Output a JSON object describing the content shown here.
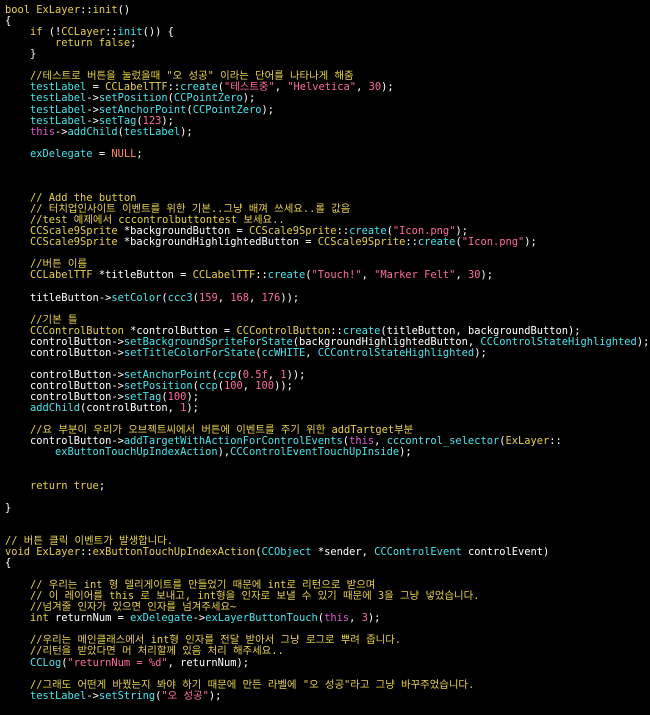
{
  "colors": {
    "background": "#000000",
    "keyword": "#e7d04a",
    "function": "#46e6ef",
    "string": "#ff6ba0",
    "text": "#ffffff",
    "comment": "#e7d04a",
    "macro": "#ff8a6a"
  },
  "lines": [
    {
      "row": 0,
      "indent": 0,
      "segments": [
        {
          "c": "kw",
          "t": "bool "
        },
        {
          "c": "ty",
          "t": "ExLayer"
        },
        {
          "c": "tx",
          "t": "::"
        },
        {
          "c": "ty",
          "t": "init"
        },
        {
          "c": "tx",
          "t": "()"
        }
      ]
    },
    {
      "row": 1,
      "indent": 0,
      "segments": [
        {
          "c": "tx",
          "t": "{"
        }
      ]
    },
    {
      "row": 2,
      "indent": 4,
      "segments": [
        {
          "c": "kw",
          "t": "if "
        },
        {
          "c": "tx",
          "t": "(!"
        },
        {
          "c": "ty",
          "t": "CCLayer"
        },
        {
          "c": "tx",
          "t": "::"
        },
        {
          "c": "fn",
          "t": "init"
        },
        {
          "c": "tx",
          "t": "()) {"
        }
      ]
    },
    {
      "row": 3,
      "indent": 8,
      "segments": [
        {
          "c": "kw",
          "t": "return false"
        },
        {
          "c": "tx",
          "t": ";"
        }
      ]
    },
    {
      "row": 4,
      "indent": 4,
      "segments": [
        {
          "c": "tx",
          "t": "}"
        }
      ]
    },
    {
      "row": 6,
      "indent": 4,
      "segments": [
        {
          "c": "cm",
          "t": "//테스트로 버튼을 눌렀을때 \"오 성공\" 이라는 단어를 나타나게 해줌"
        }
      ]
    },
    {
      "row": 7,
      "indent": 4,
      "segments": [
        {
          "c": "fn",
          "t": "testLabel"
        },
        {
          "c": "tx",
          "t": " = "
        },
        {
          "c": "ty",
          "t": "CCLabelTTF"
        },
        {
          "c": "tx",
          "t": "::"
        },
        {
          "c": "fn",
          "t": "create"
        },
        {
          "c": "tx",
          "t": "("
        },
        {
          "c": "str",
          "t": "\"테스트중\""
        },
        {
          "c": "tx",
          "t": ", "
        },
        {
          "c": "str",
          "t": "\"Helvetica\""
        },
        {
          "c": "tx",
          "t": ", "
        },
        {
          "c": "num",
          "t": "30"
        },
        {
          "c": "tx",
          "t": ");"
        }
      ]
    },
    {
      "row": 8,
      "indent": 4,
      "segments": [
        {
          "c": "fn",
          "t": "testLabel"
        },
        {
          "c": "tx",
          "t": "->"
        },
        {
          "c": "fn",
          "t": "setPosition"
        },
        {
          "c": "tx",
          "t": "("
        },
        {
          "c": "fn",
          "t": "CCPointZero"
        },
        {
          "c": "tx",
          "t": ");"
        }
      ]
    },
    {
      "row": 9,
      "indent": 4,
      "segments": [
        {
          "c": "fn",
          "t": "testLabel"
        },
        {
          "c": "tx",
          "t": "->"
        },
        {
          "c": "fn",
          "t": "setAnchorPoint"
        },
        {
          "c": "tx",
          "t": "("
        },
        {
          "c": "fn",
          "t": "CCPointZero"
        },
        {
          "c": "tx",
          "t": ");"
        }
      ]
    },
    {
      "row": 10,
      "indent": 4,
      "segments": [
        {
          "c": "fn",
          "t": "testLabel"
        },
        {
          "c": "tx",
          "t": "->"
        },
        {
          "c": "fn",
          "t": "setTag"
        },
        {
          "c": "tx",
          "t": "("
        },
        {
          "c": "num",
          "t": "123"
        },
        {
          "c": "tx",
          "t": ");"
        }
      ]
    },
    {
      "row": 11,
      "indent": 4,
      "segments": [
        {
          "c": "pk",
          "t": "this"
        },
        {
          "c": "tx",
          "t": "->"
        },
        {
          "c": "fn",
          "t": "addChild"
        },
        {
          "c": "tx",
          "t": "("
        },
        {
          "c": "fn",
          "t": "testLabel"
        },
        {
          "c": "tx",
          "t": ");"
        }
      ]
    },
    {
      "row": 13,
      "indent": 4,
      "segments": [
        {
          "c": "fn",
          "t": "exDelegate"
        },
        {
          "c": "tx",
          "t": " = "
        },
        {
          "c": "mac",
          "t": "NULL"
        },
        {
          "c": "tx",
          "t": ";"
        }
      ]
    },
    {
      "row": 17,
      "indent": 4,
      "segments": [
        {
          "c": "cm",
          "t": "// Add the button"
        }
      ]
    },
    {
      "row": 18,
      "indent": 4,
      "segments": [
        {
          "c": "cm",
          "t": "// 터치업인사이트 이벤트를 위한 기본..그냥 배껴 쓰세요..롤 값음"
        }
      ]
    },
    {
      "row": 19,
      "indent": 4,
      "segments": [
        {
          "c": "cm",
          "t": "//test 예제에서 cccontrolbuttontest 보세요.."
        }
      ]
    },
    {
      "row": 20,
      "indent": 4,
      "segments": [
        {
          "c": "ty",
          "t": "CCScale9Sprite"
        },
        {
          "c": "tx",
          "t": " *backgroundButton = "
        },
        {
          "c": "ty",
          "t": "CCScale9Sprite"
        },
        {
          "c": "tx",
          "t": "::"
        },
        {
          "c": "fn",
          "t": "create"
        },
        {
          "c": "tx",
          "t": "("
        },
        {
          "c": "str",
          "t": "\"Icon.png\""
        },
        {
          "c": "tx",
          "t": ");"
        }
      ]
    },
    {
      "row": 21,
      "indent": 4,
      "segments": [
        {
          "c": "ty",
          "t": "CCScale9Sprite"
        },
        {
          "c": "tx",
          "t": " *backgroundHighlightedButton = "
        },
        {
          "c": "ty",
          "t": "CCScale9Sprite"
        },
        {
          "c": "tx",
          "t": "::"
        },
        {
          "c": "fn",
          "t": "create"
        },
        {
          "c": "tx",
          "t": "("
        },
        {
          "c": "str",
          "t": "\"Icon.png\""
        },
        {
          "c": "tx",
          "t": ");"
        }
      ]
    },
    {
      "row": 23,
      "indent": 4,
      "segments": [
        {
          "c": "cm",
          "t": "//버튼 이름"
        }
      ]
    },
    {
      "row": 24,
      "indent": 4,
      "segments": [
        {
          "c": "ty",
          "t": "CCLabelTTF"
        },
        {
          "c": "tx",
          "t": " *titleButton = "
        },
        {
          "c": "ty",
          "t": "CCLabelTTF"
        },
        {
          "c": "tx",
          "t": "::"
        },
        {
          "c": "fn",
          "t": "create"
        },
        {
          "c": "tx",
          "t": "("
        },
        {
          "c": "str",
          "t": "\"Touch!\""
        },
        {
          "c": "tx",
          "t": ", "
        },
        {
          "c": "str",
          "t": "\"Marker Felt\""
        },
        {
          "c": "tx",
          "t": ", "
        },
        {
          "c": "num",
          "t": "30"
        },
        {
          "c": "tx",
          "t": ");"
        }
      ]
    },
    {
      "row": 26,
      "indent": 4,
      "segments": [
        {
          "c": "tx",
          "t": "titleButton->"
        },
        {
          "c": "fn",
          "t": "setColor"
        },
        {
          "c": "tx",
          "t": "("
        },
        {
          "c": "fn",
          "t": "ccc3"
        },
        {
          "c": "tx",
          "t": "("
        },
        {
          "c": "num",
          "t": "159"
        },
        {
          "c": "tx",
          "t": ", "
        },
        {
          "c": "num",
          "t": "168"
        },
        {
          "c": "tx",
          "t": ", "
        },
        {
          "c": "num",
          "t": "176"
        },
        {
          "c": "tx",
          "t": "));"
        }
      ]
    },
    {
      "row": 28,
      "indent": 4,
      "segments": [
        {
          "c": "cm",
          "t": "//기본 틀"
        }
      ]
    },
    {
      "row": 29,
      "indent": 4,
      "segments": [
        {
          "c": "ty",
          "t": "CCControlButton"
        },
        {
          "c": "tx",
          "t": " *controlButton = "
        },
        {
          "c": "ty",
          "t": "CCControlButton"
        },
        {
          "c": "tx",
          "t": "::"
        },
        {
          "c": "fn",
          "t": "create"
        },
        {
          "c": "tx",
          "t": "(titleButton, backgroundButton);"
        }
      ]
    },
    {
      "row": 30,
      "indent": 4,
      "segments": [
        {
          "c": "tx",
          "t": "controlButton->"
        },
        {
          "c": "fn",
          "t": "setBackgroundSpriteForState"
        },
        {
          "c": "tx",
          "t": "(backgroundHighlightedButton, "
        },
        {
          "c": "fn",
          "t": "CCControlStateHighlighted"
        },
        {
          "c": "tx",
          "t": ");"
        }
      ]
    },
    {
      "row": 31,
      "indent": 4,
      "segments": [
        {
          "c": "tx",
          "t": "controlButton->"
        },
        {
          "c": "fn",
          "t": "setTitleColorForState"
        },
        {
          "c": "tx",
          "t": "("
        },
        {
          "c": "fn",
          "t": "ccWHITE"
        },
        {
          "c": "tx",
          "t": ", "
        },
        {
          "c": "fn",
          "t": "CCControlStateHighlighted"
        },
        {
          "c": "tx",
          "t": ");"
        }
      ]
    },
    {
      "row": 33,
      "indent": 4,
      "segments": [
        {
          "c": "tx",
          "t": "controlButton->"
        },
        {
          "c": "fn",
          "t": "setAnchorPoint"
        },
        {
          "c": "tx",
          "t": "("
        },
        {
          "c": "fn",
          "t": "ccp"
        },
        {
          "c": "tx",
          "t": "("
        },
        {
          "c": "num",
          "t": "0.5f"
        },
        {
          "c": "tx",
          "t": ", "
        },
        {
          "c": "num",
          "t": "1"
        },
        {
          "c": "tx",
          "t": "));"
        }
      ]
    },
    {
      "row": 34,
      "indent": 4,
      "segments": [
        {
          "c": "tx",
          "t": "controlButton->"
        },
        {
          "c": "fn",
          "t": "setPosition"
        },
        {
          "c": "tx",
          "t": "("
        },
        {
          "c": "fn",
          "t": "ccp"
        },
        {
          "c": "tx",
          "t": "("
        },
        {
          "c": "num",
          "t": "100"
        },
        {
          "c": "tx",
          "t": ", "
        },
        {
          "c": "num",
          "t": "100"
        },
        {
          "c": "tx",
          "t": "));"
        }
      ]
    },
    {
      "row": 35,
      "indent": 4,
      "segments": [
        {
          "c": "tx",
          "t": "controlButton->"
        },
        {
          "c": "fn",
          "t": "setTag"
        },
        {
          "c": "tx",
          "t": "("
        },
        {
          "c": "num",
          "t": "100"
        },
        {
          "c": "tx",
          "t": ");"
        }
      ]
    },
    {
      "row": 36,
      "indent": 4,
      "segments": [
        {
          "c": "fn",
          "t": "addChild"
        },
        {
          "c": "tx",
          "t": "(controlButton, "
        },
        {
          "c": "num",
          "t": "1"
        },
        {
          "c": "tx",
          "t": ");"
        }
      ]
    },
    {
      "row": 38,
      "indent": 4,
      "segments": [
        {
          "c": "cm",
          "t": "//요 부분이 우리가 오브젝트씨에서 버튼에 이벤트를 주기 위한 addTartget부분"
        }
      ]
    },
    {
      "row": 39,
      "indent": 4,
      "segments": [
        {
          "c": "tx",
          "t": "controlButton->"
        },
        {
          "c": "fn",
          "t": "addTargetWithActionForControlEvents"
        },
        {
          "c": "tx",
          "t": "("
        },
        {
          "c": "pk",
          "t": "this"
        },
        {
          "c": "tx",
          "t": ", "
        },
        {
          "c": "fn",
          "t": "cccontrol_selector"
        },
        {
          "c": "tx",
          "t": "("
        },
        {
          "c": "ty",
          "t": "ExLayer"
        },
        {
          "c": "tx",
          "t": "::"
        }
      ]
    },
    {
      "row": 40,
      "indent": 8,
      "segments": [
        {
          "c": "fn",
          "t": "exButtonTouchUpIndexAction"
        },
        {
          "c": "tx",
          "t": "),"
        },
        {
          "c": "fn",
          "t": "CCControlEventTouchUpInside"
        },
        {
          "c": "tx",
          "t": ");"
        }
      ]
    },
    {
      "row": 43,
      "indent": 4,
      "segments": [
        {
          "c": "kw",
          "t": "return true"
        },
        {
          "c": "tx",
          "t": ";"
        }
      ]
    },
    {
      "row": 45,
      "indent": 0,
      "segments": [
        {
          "c": "tx",
          "t": "}"
        }
      ]
    },
    {
      "row": 48,
      "indent": 0,
      "segments": [
        {
          "c": "cm",
          "t": "// 버튼 클릭 이벤트가 발생합니다."
        }
      ]
    },
    {
      "row": 49,
      "indent": 0,
      "segments": [
        {
          "c": "kw",
          "t": "void "
        },
        {
          "c": "ty",
          "t": "ExLayer"
        },
        {
          "c": "tx",
          "t": "::"
        },
        {
          "c": "ty",
          "t": "exButtonTouchUpIndexAction"
        },
        {
          "c": "tx",
          "t": "("
        },
        {
          "c": "fn",
          "t": "CCObject"
        },
        {
          "c": "tx",
          "t": " *sender, "
        },
        {
          "c": "fn",
          "t": "CCControlEvent"
        },
        {
          "c": "tx",
          "t": " controlEvent)"
        }
      ]
    },
    {
      "row": 50,
      "indent": 0,
      "segments": [
        {
          "c": "tx",
          "t": "{"
        }
      ]
    },
    {
      "row": 52,
      "indent": 4,
      "segments": [
        {
          "c": "cm",
          "t": "// 우리는 int 형 델리게이트를 만들었기 때문에 int로 리턴으로 받으며"
        }
      ]
    },
    {
      "row": 53,
      "indent": 4,
      "segments": [
        {
          "c": "cm",
          "t": "// 이 레이어를 this 로 보내고, int형을 인자로 보낼 수 있기 때문에 3을 그냥 넣었습니다."
        }
      ]
    },
    {
      "row": 54,
      "indent": 4,
      "segments": [
        {
          "c": "cm",
          "t": "//넘겨줄 인자가 있으면 인자를 넘겨주세요~"
        }
      ]
    },
    {
      "row": 55,
      "indent": 4,
      "segments": [
        {
          "c": "kw",
          "t": "int "
        },
        {
          "c": "tx",
          "t": "returnNum = "
        },
        {
          "c": "fn",
          "t": "exDelegate"
        },
        {
          "c": "tx",
          "t": "->"
        },
        {
          "c": "fn",
          "t": "exLayerButtonTouch"
        },
        {
          "c": "tx",
          "t": "("
        },
        {
          "c": "pk",
          "t": "this"
        },
        {
          "c": "tx",
          "t": ", "
        },
        {
          "c": "num",
          "t": "3"
        },
        {
          "c": "tx",
          "t": ");"
        }
      ]
    },
    {
      "row": 57,
      "indent": 4,
      "segments": [
        {
          "c": "cm",
          "t": "//우리는 메인클래스에서 int형 인자를 전달 받아서 그냥 로그로 뿌려 줍니다."
        }
      ]
    },
    {
      "row": 58,
      "indent": 4,
      "segments": [
        {
          "c": "cm",
          "t": "//리턴을 받았다면 머 처리할께 있음 처리 해주세요.."
        }
      ]
    },
    {
      "row": 59,
      "indent": 4,
      "segments": [
        {
          "c": "fn",
          "t": "CCLog"
        },
        {
          "c": "tx",
          "t": "("
        },
        {
          "c": "str",
          "t": "\"returnNum = %d\""
        },
        {
          "c": "tx",
          "t": ", returnNum);"
        }
      ]
    },
    {
      "row": 61,
      "indent": 4,
      "segments": [
        {
          "c": "cm",
          "t": "//그래도 어떤게 바꿨는지 봐야 하기 때문에 만든 라벨에 \"오 성공\"라고 그냥 바꾸주었습니다."
        }
      ]
    },
    {
      "row": 62,
      "indent": 4,
      "segments": [
        {
          "c": "fn",
          "t": "testLabel"
        },
        {
          "c": "tx",
          "t": "->"
        },
        {
          "c": "fn",
          "t": "setString"
        },
        {
          "c": "tx",
          "t": "("
        },
        {
          "c": "str",
          "t": "\"오 성공\""
        },
        {
          "c": "tx",
          "t": ");"
        }
      ]
    }
  ]
}
